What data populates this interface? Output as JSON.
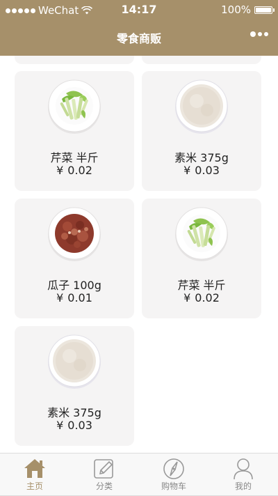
{
  "status_bar": {
    "carrier": "WeChat",
    "time": "14:17",
    "battery": "100%"
  },
  "nav": {
    "title": "零食商贩"
  },
  "products": [
    {
      "name": "芹菜 半斤",
      "currency": "¥",
      "price": "0.02",
      "image": "celery-plate"
    },
    {
      "name": "素米 375g",
      "currency": "¥",
      "price": "0.03",
      "image": "rice-plate"
    },
    {
      "name": "瓜子 100g",
      "currency": "¥",
      "price": "0.01",
      "image": "meat-plate"
    },
    {
      "name": "芹菜 半斤",
      "currency": "¥",
      "price": "0.02",
      "image": "celery-plate"
    },
    {
      "name": "素米 375g",
      "currency": "¥",
      "price": "0.03",
      "image": "rice-plate"
    }
  ],
  "tabbar": {
    "items": [
      {
        "label": "主页",
        "icon": "home-icon",
        "active": true
      },
      {
        "label": "分类",
        "icon": "edit-icon",
        "active": false
      },
      {
        "label": "购物车",
        "icon": "compass-icon",
        "active": false
      },
      {
        "label": "我的",
        "icon": "user-icon",
        "active": false
      }
    ]
  },
  "colors": {
    "brand": "#a6906a",
    "card_bg": "#f5f4f4",
    "tab_inactive": "#888888"
  }
}
